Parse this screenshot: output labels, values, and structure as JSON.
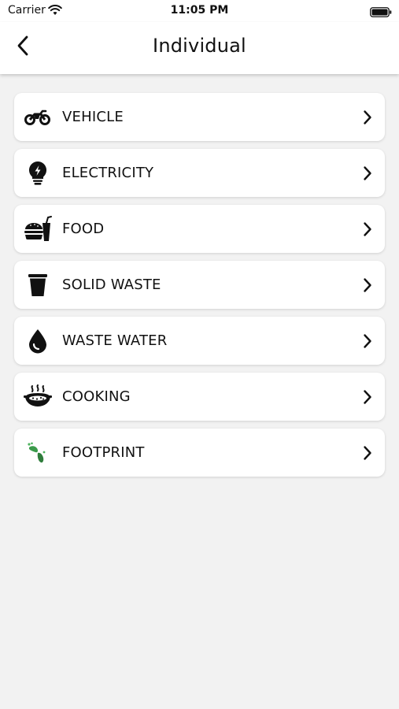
{
  "status_bar": {
    "carrier": "Carrier",
    "time": "11:05 PM"
  },
  "header": {
    "title": "Individual",
    "back_icon": "chevron-left-icon"
  },
  "menu": {
    "items": [
      {
        "label": "VEHICLE",
        "icon": "motorcycle-icon"
      },
      {
        "label": "ELECTRICITY",
        "icon": "lightbulb-icon"
      },
      {
        "label": "FOOD",
        "icon": "burger-drink-icon"
      },
      {
        "label": "SOLID WASTE",
        "icon": "trash-bin-icon"
      },
      {
        "label": "WASTE WATER",
        "icon": "water-drop-icon"
      },
      {
        "label": "COOKING",
        "icon": "cooking-pot-icon"
      },
      {
        "label": "FOOTPRINT",
        "icon": "footprint-icon"
      }
    ]
  },
  "colors": {
    "background": "#f2f2f2",
    "card": "#ffffff",
    "text": "#111111",
    "footprint_green": "#3a9a4a"
  }
}
